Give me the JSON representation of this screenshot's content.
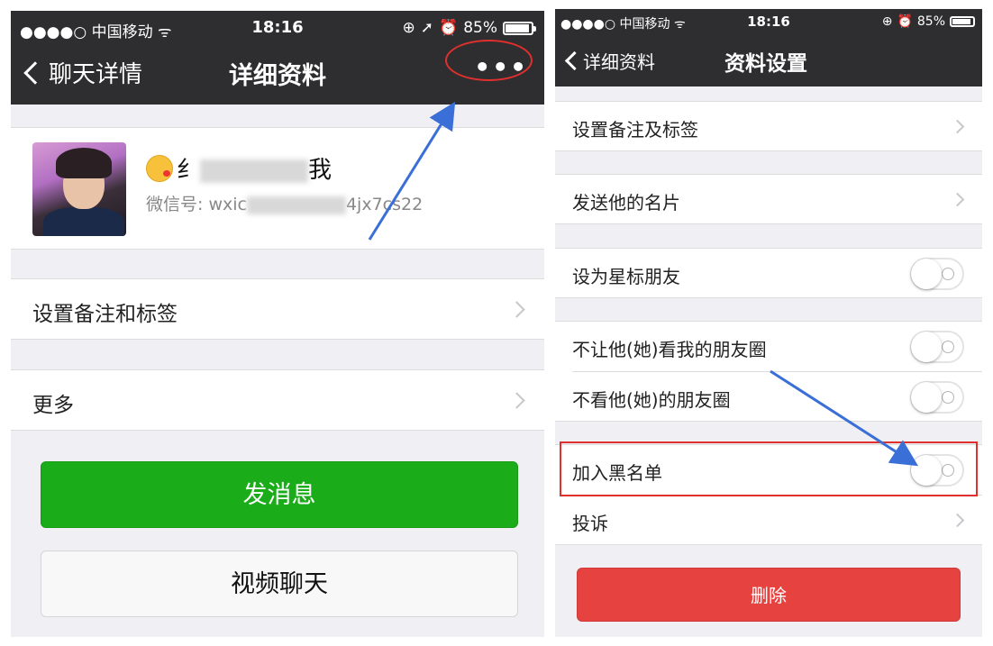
{
  "left": {
    "status": {
      "carrier": "●●●●○ 中国移动 ᯤ",
      "time": "18:16",
      "battery": "85%"
    },
    "nav": {
      "back": "聊天详情",
      "title": "详细资料",
      "more": "•••"
    },
    "profile": {
      "nickname_visible": "纟",
      "nickname_tail": "我",
      "wechat_label": "微信号:",
      "wechat_prefix": "wxic",
      "wechat_suffix": "4jx7cs22"
    },
    "cells": [
      {
        "label": "设置备注和标签"
      },
      {
        "label": "更多"
      }
    ],
    "buttons": {
      "message": "发消息",
      "video": "视频聊天"
    }
  },
  "right": {
    "status": {
      "carrier": "●●●●○ 中国移动 ᯤ",
      "time": "18:16",
      "battery": "85%"
    },
    "nav": {
      "back": "详细资料",
      "title": "资料设置"
    },
    "cells": [
      {
        "label": "设置备注及标签",
        "control": "chevron"
      },
      {
        "label": "发送他的名片",
        "control": "chevron"
      },
      {
        "label": "设为星标朋友",
        "control": "toggle",
        "on": false
      },
      {
        "label": "不让他(她)看我的朋友圈",
        "control": "toggle",
        "on": false
      },
      {
        "label": "不看他(她)的朋友圈",
        "control": "toggle",
        "on": false
      },
      {
        "label": "加入黑名单",
        "control": "toggle",
        "on": false
      },
      {
        "label": "投诉",
        "control": "chevron"
      }
    ],
    "delete_button": "删除"
  },
  "colors": {
    "nav_bg": "#2e2e30",
    "green": "#1aad19",
    "red": "#e64340",
    "annotation": "#e0302d",
    "arrow": "#3a6fd8"
  }
}
